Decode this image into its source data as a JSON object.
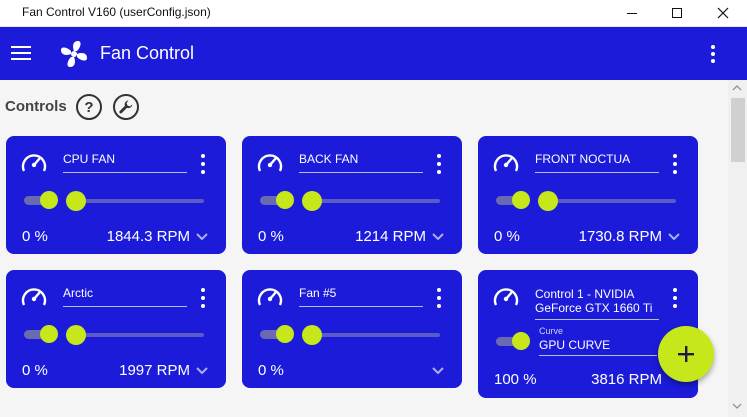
{
  "window": {
    "title": "Fan Control V160 (userConfig.json)",
    "minimize_icon": "minimize-icon",
    "maximize_icon": "maximize-icon",
    "close_icon": "close-icon"
  },
  "appbar": {
    "title": "Fan Control",
    "menu_icon": "hamburger-icon",
    "logo_icon": "fan-logo-icon",
    "more_icon": "more-vertical-icon"
  },
  "section": {
    "label": "Controls",
    "help_label": "?",
    "help_icon": "help-icon",
    "settings_icon": "wrench-icon"
  },
  "cards": [
    {
      "name": "CPU FAN",
      "percent": "0 %",
      "rpm": "1844.3 RPM",
      "enabled": true,
      "slider_value": 0
    },
    {
      "name": "BACK FAN",
      "percent": "0 %",
      "rpm": "1214 RPM",
      "enabled": true,
      "slider_value": 0
    },
    {
      "name": "FRONT NOCTUA",
      "percent": "0 %",
      "rpm": "1730.8 RPM",
      "enabled": true,
      "slider_value": 0
    },
    {
      "name": "Arctic",
      "percent": "0 %",
      "rpm": "1997 RPM",
      "enabled": true,
      "slider_value": 0
    },
    {
      "name": "Fan #5",
      "percent": "0 %",
      "rpm": "",
      "enabled": true,
      "slider_value": 0
    },
    {
      "name": "Control 1 - NVIDIA GeForce GTX 1660 Ti",
      "percent": "100 %",
      "rpm": "3816 RPM",
      "enabled": true,
      "curve_label": "Curve",
      "curve_name": "GPU CURVE"
    }
  ],
  "fab": {
    "label": "+",
    "icon": "add-icon"
  },
  "colors": {
    "primary": "#1b1bd9",
    "accent": "#c6e81a",
    "background": "#f5f5f5"
  }
}
